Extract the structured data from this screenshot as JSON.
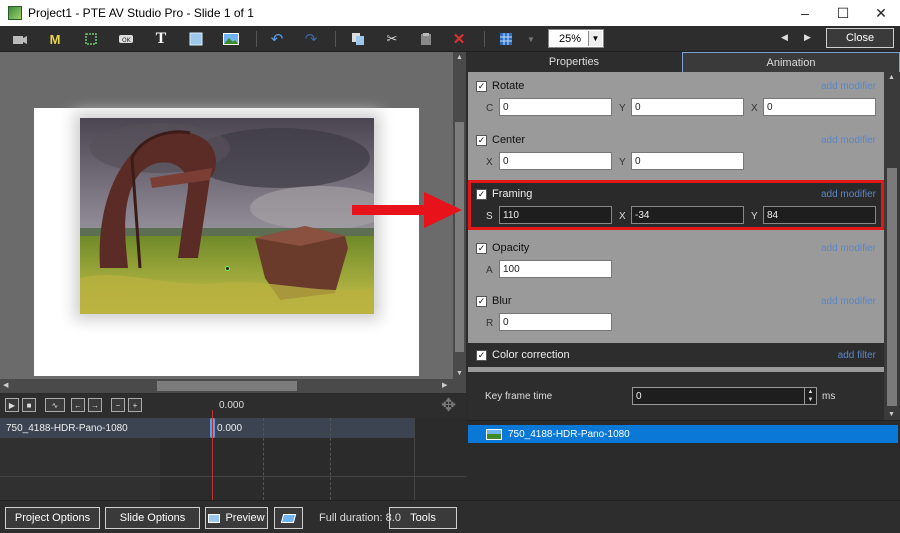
{
  "window": {
    "title": "Project1 - PTE AV Studio Pro - Slide 1 of 1",
    "controls": [
      "–",
      "☐",
      "✕"
    ]
  },
  "toolbar": {
    "zoom": "25%",
    "close_label": "Close",
    "icons": [
      "camera-icon",
      "mask-icon",
      "frame-icon",
      "ok-button-icon",
      "text-icon",
      "rectangle-icon",
      "image-icon",
      "undo-icon",
      "redo-icon",
      "copy-icon",
      "cut-icon",
      "paste-icon",
      "delete-icon",
      "grid-icon",
      "grid-dropdown-icon"
    ]
  },
  "tabs": {
    "properties": "Properties",
    "animation": "Animation"
  },
  "animation": {
    "rotate": {
      "label": "Rotate",
      "add": "add modifier",
      "c_label": "C",
      "c": "0",
      "y_label": "Y",
      "y": "0",
      "x_label": "X",
      "x": "0"
    },
    "center": {
      "label": "Center",
      "add": "add modifier",
      "x_label": "X",
      "x": "0",
      "y_label": "Y",
      "y": "0"
    },
    "framing": {
      "label": "Framing",
      "add": "add modifier",
      "s_label": "S",
      "s": "110",
      "x_label": "X",
      "x": "-34",
      "y_label": "Y",
      "y": "84"
    },
    "opacity": {
      "label": "Opacity",
      "add": "add modifier",
      "a_label": "A",
      "a": "100"
    },
    "blur": {
      "label": "Blur",
      "add": "add modifier",
      "r_label": "R",
      "r": "0"
    },
    "color_correction": {
      "label": "Color correction",
      "add": "add filter"
    },
    "keyframe": {
      "label": "Key frame time",
      "value": "0",
      "unit": "ms"
    }
  },
  "objects": [
    {
      "name": "750_4188-HDR-Pano-1080"
    }
  ],
  "timeline": {
    "timecode": "0.000",
    "rows": [
      {
        "label": "750_4188-HDR-Pano-1080",
        "key_time": "0.000"
      }
    ]
  },
  "bottom": {
    "project_options": "Project Options",
    "slide_options": "Slide Options",
    "preview": "Preview",
    "duration": "Full duration: 8.0",
    "tools": "Tools"
  },
  "colors": {
    "accent": "#0a78d7",
    "highlight": "#e01818",
    "add_link": "#5b86c6"
  }
}
